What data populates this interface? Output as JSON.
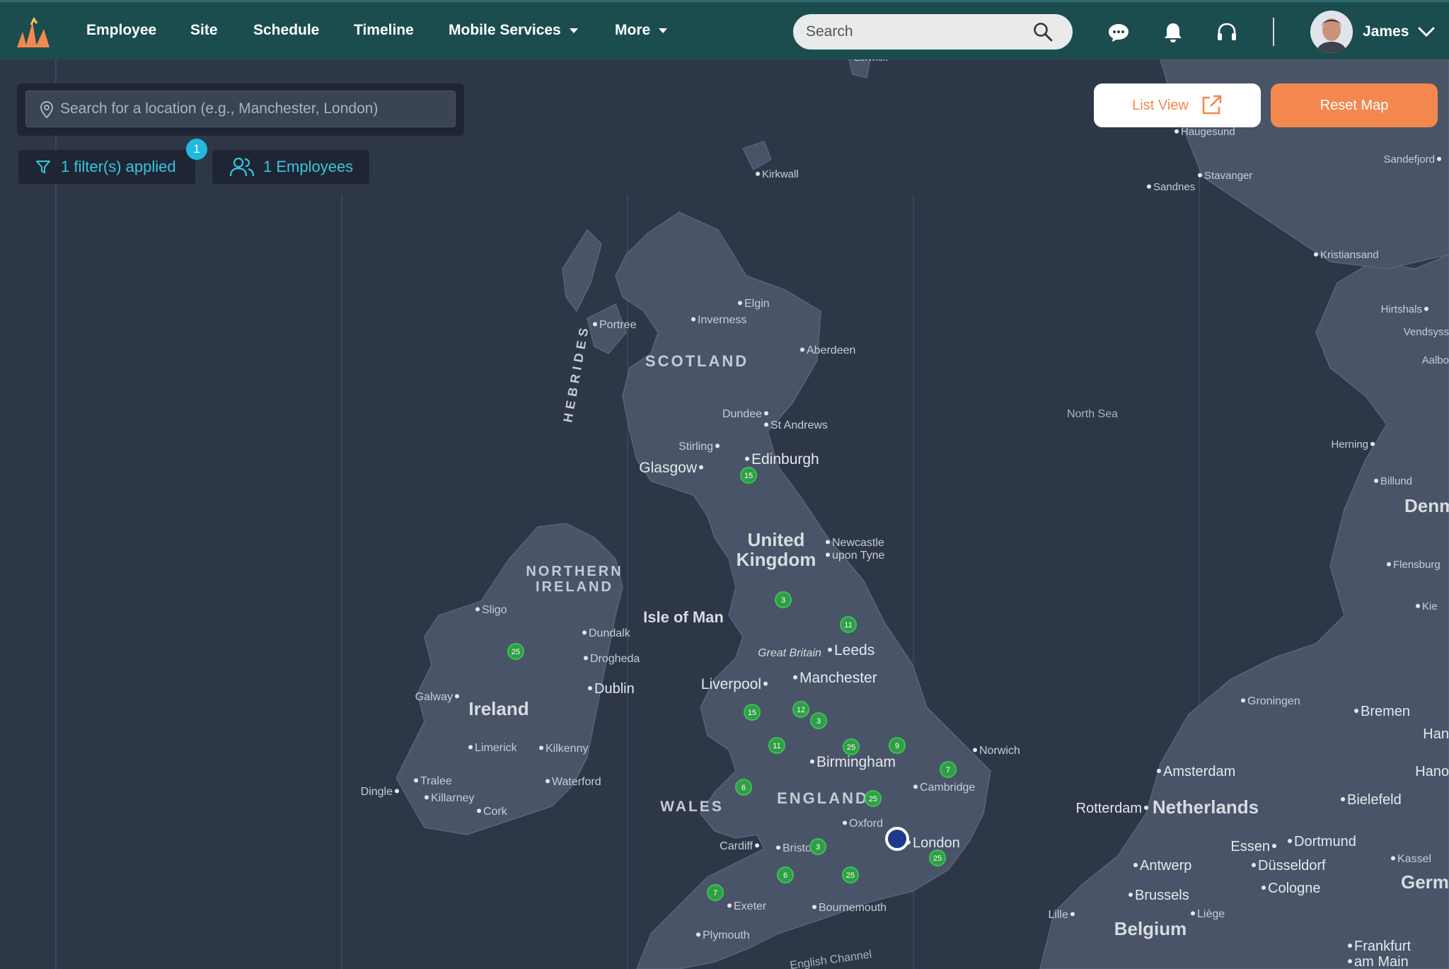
{
  "nav": {
    "items": [
      {
        "label": "Employee"
      },
      {
        "label": "Site"
      },
      {
        "label": "Schedule"
      },
      {
        "label": "Timeline"
      },
      {
        "label": "Mobile Services"
      },
      {
        "label": "More"
      }
    ]
  },
  "search": {
    "placeholder": "Search"
  },
  "user": {
    "name": "James"
  },
  "location_search": {
    "placeholder": "Search for a location (e.g., Manchester, London)"
  },
  "filters": {
    "label": "1 filter(s) applied",
    "badge": "1"
  },
  "employees": {
    "label": "1 Employees"
  },
  "buttons": {
    "list_view": "List View",
    "reset_map": "Reset Map"
  },
  "colors": {
    "topbar": "#1b4d4f",
    "accent": "#f3884f",
    "cyan": "#39c4e0",
    "map_bg": "#2d3748",
    "land": "#4a5468",
    "cluster": "#2f9e44"
  },
  "map": {
    "regions": [
      "SCOTLAND",
      "NORTHERN",
      "IRELAND",
      "WALES",
      "ENGLAND",
      "HEBRIDES"
    ],
    "countries": [
      "United",
      "Kingdom",
      "Ireland",
      "Netherlands",
      "Belgium",
      "Denma",
      "Germ"
    ],
    "seas": [
      "North Sea",
      "English Channel"
    ],
    "places": [
      "Isle of Man",
      "Great Britain"
    ],
    "cities": [
      "Lerwick",
      "Kirkwall",
      "Haugesund",
      "Stavanger",
      "Sandnes",
      "Sandefjord",
      "Kristiansand",
      "Hirtshals",
      "Vendsyss",
      "Aalbo",
      "Elgin",
      "Inverness",
      "Portree",
      "Aberdeen",
      "Dundee",
      "St Andrews",
      "Stirling",
      "Edinburgh",
      "Glasgow",
      "Newcastle",
      "upon Tyne",
      "Herning",
      "Billund",
      "Flensburg",
      "Kie",
      "Sligo",
      "Dundalk",
      "Drogheda",
      "Dublin",
      "Galway",
      "Leeds",
      "Manchester",
      "Liverpool",
      "Limerick",
      "Kilkenny",
      "Tralee",
      "Killarney",
      "Dingle",
      "Waterford",
      "Cork",
      "Birmingham",
      "Norwich",
      "Cambridge",
      "Oxford",
      "London",
      "Cardiff",
      "Bristol",
      "Exeter",
      "Bournemouth",
      "Plymouth",
      "Groningen",
      "Bremen",
      "Han",
      "Amsterdam",
      "Hano",
      "Rotterdam",
      "Bielefeld",
      "Essen",
      "Dortmund",
      "Antwerp",
      "Düsseldorf",
      "Kassel",
      "Brussels",
      "Cologne",
      "Lille",
      "Liège",
      "Frankfurt",
      "am Main"
    ],
    "clusters": [
      "15",
      "3",
      "11",
      "25",
      "15",
      "12",
      "3",
      "11",
      "25",
      "9",
      "7",
      "6",
      "25",
      "3",
      "6",
      "25",
      "7",
      "25"
    ]
  }
}
